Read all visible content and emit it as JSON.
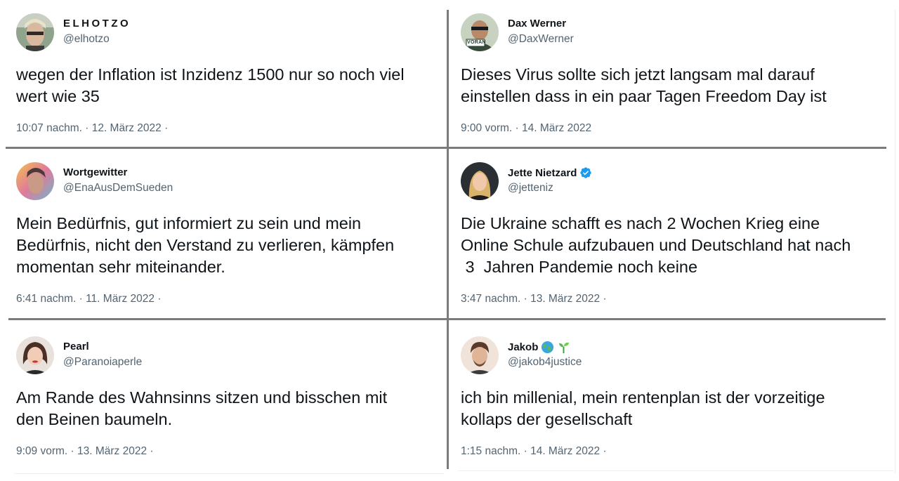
{
  "tweets": [
    {
      "name": "ELHOTZO",
      "handle": "@elhotzo",
      "text_lines": [
        "wegen der Inflation ist Inzidenz 1500 nur so noch viel",
        "wert wie 35"
      ],
      "timestamp": "10:07 nachm. · 12. März 2022 ·",
      "verified": false
    },
    {
      "name": "Dax Werner",
      "handle": "@DaxWerner",
      "avatar_badge": "VORAN",
      "text_lines": [
        "Dieses Virus sollte sich jetzt langsam mal darauf",
        "einstellen dass in ein paar Tagen Freedom Day ist"
      ],
      "timestamp": "9:00 vorm. · 14. März 2022",
      "verified": false
    },
    {
      "name": "Wortgewitter",
      "handle": "@EnaAusDemSueden",
      "text_lines": [
        "Mein Bedürfnis, gut informiert zu sein und mein",
        "Bedürfnis, nicht den Verstand zu verlieren, kämpfen",
        "momentan sehr miteinander."
      ],
      "timestamp": "6:41 nachm. · 11. März 2022 ·",
      "verified": false
    },
    {
      "name": "Jette Nietzard",
      "handle": "@jetteniz",
      "text_lines": [
        "Die Ukraine schafft es nach 2 Wochen Krieg eine",
        "Online Schule aufzubauen und Deutschland hat nach",
        " 3  Jahren Pandemie noch keine"
      ],
      "timestamp": "3:47 nachm. · 13. März 2022 ·",
      "verified": true
    },
    {
      "name": "Pearl",
      "handle": "@Paranoiaperle",
      "text_lines": [
        "Am Rande des Wahnsinns sitzen und bisschen mit",
        "den Beinen baumeln."
      ],
      "timestamp": "9:09 vorm. · 13. März 2022 · ",
      "verified": false
    },
    {
      "name": "Jakob",
      "handle": "@jakob4justice",
      "name_emojis": [
        "globe-icon",
        "seedling-icon"
      ],
      "text_lines": [
        "ich bin millenial, mein rentenplan ist der vorzeitige",
        "kollaps der gesellschaft"
      ],
      "timestamp": "1:15 nachm. · 14. März 2022 ·",
      "verified": false
    }
  ],
  "colors": {
    "text": "#0f1419",
    "secondary": "#536471",
    "divider": "#7b7b7b",
    "verified": "#1d9bf0"
  }
}
